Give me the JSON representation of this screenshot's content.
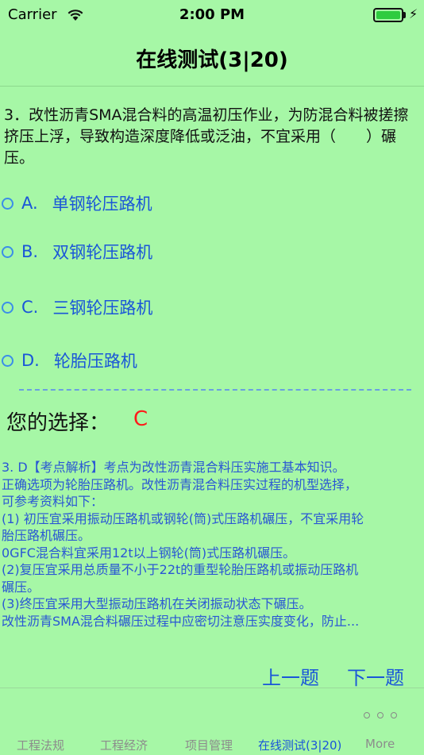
{
  "status": {
    "carrier": "Carrier",
    "time": "2:00 PM"
  },
  "nav": {
    "title": "在线测试(3|20)"
  },
  "question": {
    "text": "3．改性沥青SMA混合料的高温初压作业，为防混合料被搓擦挤压上浮，导致构造深度降低或泛油，不宜采用（　　）碾压。"
  },
  "options": [
    {
      "letter": "A.",
      "text": "单钢轮压路机"
    },
    {
      "letter": "B.",
      "text": "双钢轮压路机"
    },
    {
      "letter": "C.",
      "text": "三钢轮压路机"
    },
    {
      "letter": "D.",
      "text": "轮胎压路机"
    }
  ],
  "choice": {
    "label": "您的选择：",
    "value": "C"
  },
  "explanation": {
    "lines": [
      "3. D【考点解析】考点为改性沥青混合料压实施工基本知识。",
      "正确选项为轮胎压路机。改性沥青混合料压实过程的机型选择，",
      "可参考资料如下：",
      "(1) 初压宜采用振动压路机或钢轮(筒)式压路机碾压，不宜采用轮",
      "胎压路机碾压。",
      "0GFC混合料宜采用12t以上钢轮(筒)式压路机碾压。",
      "(2)复压宜采用总质量不小于22t的重型轮胎压路机或振动压路机",
      "碾压。",
      "(3)终压宜采用大型振动压路机在关闭振动状态下碾压。",
      "改性沥青SMA混合料碾压过程中应密切注意压实度变化，防止..."
    ]
  },
  "buttons": {
    "prev": "上一题",
    "next": "下一题"
  },
  "tabs": [
    {
      "label": "工程法规"
    },
    {
      "label": "工程经济"
    },
    {
      "label": "项目管理"
    },
    {
      "label": "在线测试(3|20)"
    },
    {
      "label": "More"
    }
  ],
  "colors": {
    "background": "#a6f7a6",
    "accent": "#1a56d8",
    "choice": "#ff1a1a"
  }
}
